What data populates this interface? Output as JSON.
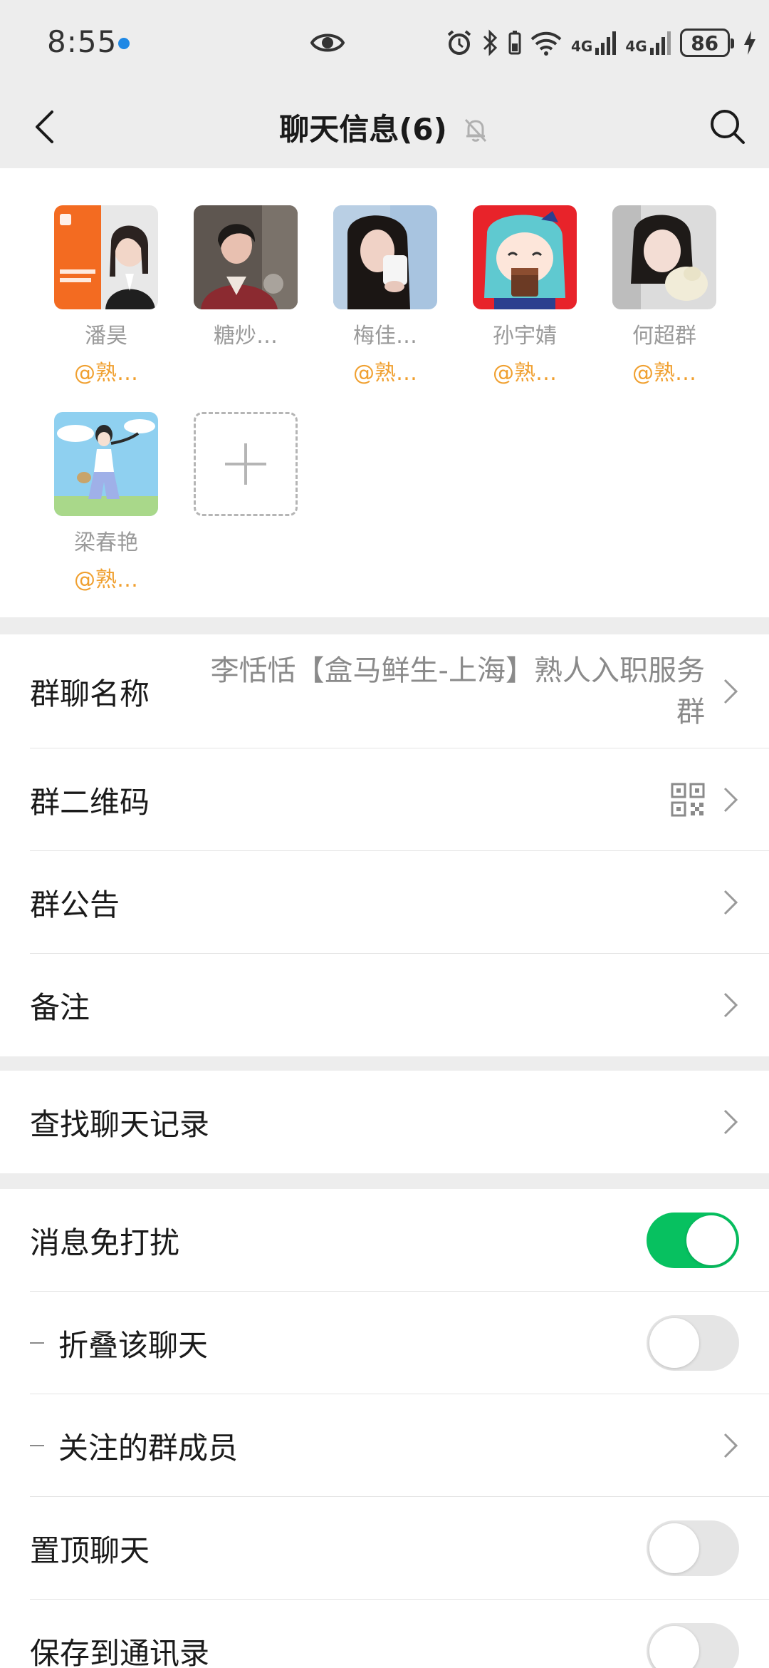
{
  "status_bar": {
    "time": "8:55",
    "network_1": "4G",
    "network_2": "4G",
    "battery": "86"
  },
  "nav": {
    "title": "聊天信息(6)",
    "back_icon": "chevron-left-icon",
    "mute_icon": "bell-off-icon",
    "search_icon": "search-icon"
  },
  "members": [
    {
      "name": "潘昊",
      "tag": "@熟…"
    },
    {
      "name": "糖炒…",
      "tag": ""
    },
    {
      "name": "梅佳…",
      "tag": "@熟…"
    },
    {
      "name": "孙宇婧",
      "tag": "@熟…"
    },
    {
      "name": "何超群",
      "tag": "@熟…"
    },
    {
      "name": "梁春艳",
      "tag": "@熟…"
    }
  ],
  "add_member_icon": "plus-icon",
  "group_name": {
    "label": "群聊名称",
    "value": "李恬恬【盒马鲜生-上海】熟人入职服务群"
  },
  "qr_code": {
    "label": "群二维码",
    "icon": "qr-code-icon"
  },
  "announcement": {
    "label": "群公告"
  },
  "remark": {
    "label": "备注"
  },
  "search_history": {
    "label": "查找聊天记录"
  },
  "settings": {
    "mute": {
      "label": "消息免打扰",
      "on": true
    },
    "fold": {
      "label": "折叠该聊天",
      "on": false
    },
    "followed": {
      "label": "关注的群成员"
    },
    "pin": {
      "label": "置顶聊天",
      "on": false
    },
    "save": {
      "label": "保存到通讯录",
      "on": false
    }
  },
  "colors": {
    "accent_green": "#07c160",
    "tag_orange": "#f0a030",
    "background": "#ededed"
  }
}
